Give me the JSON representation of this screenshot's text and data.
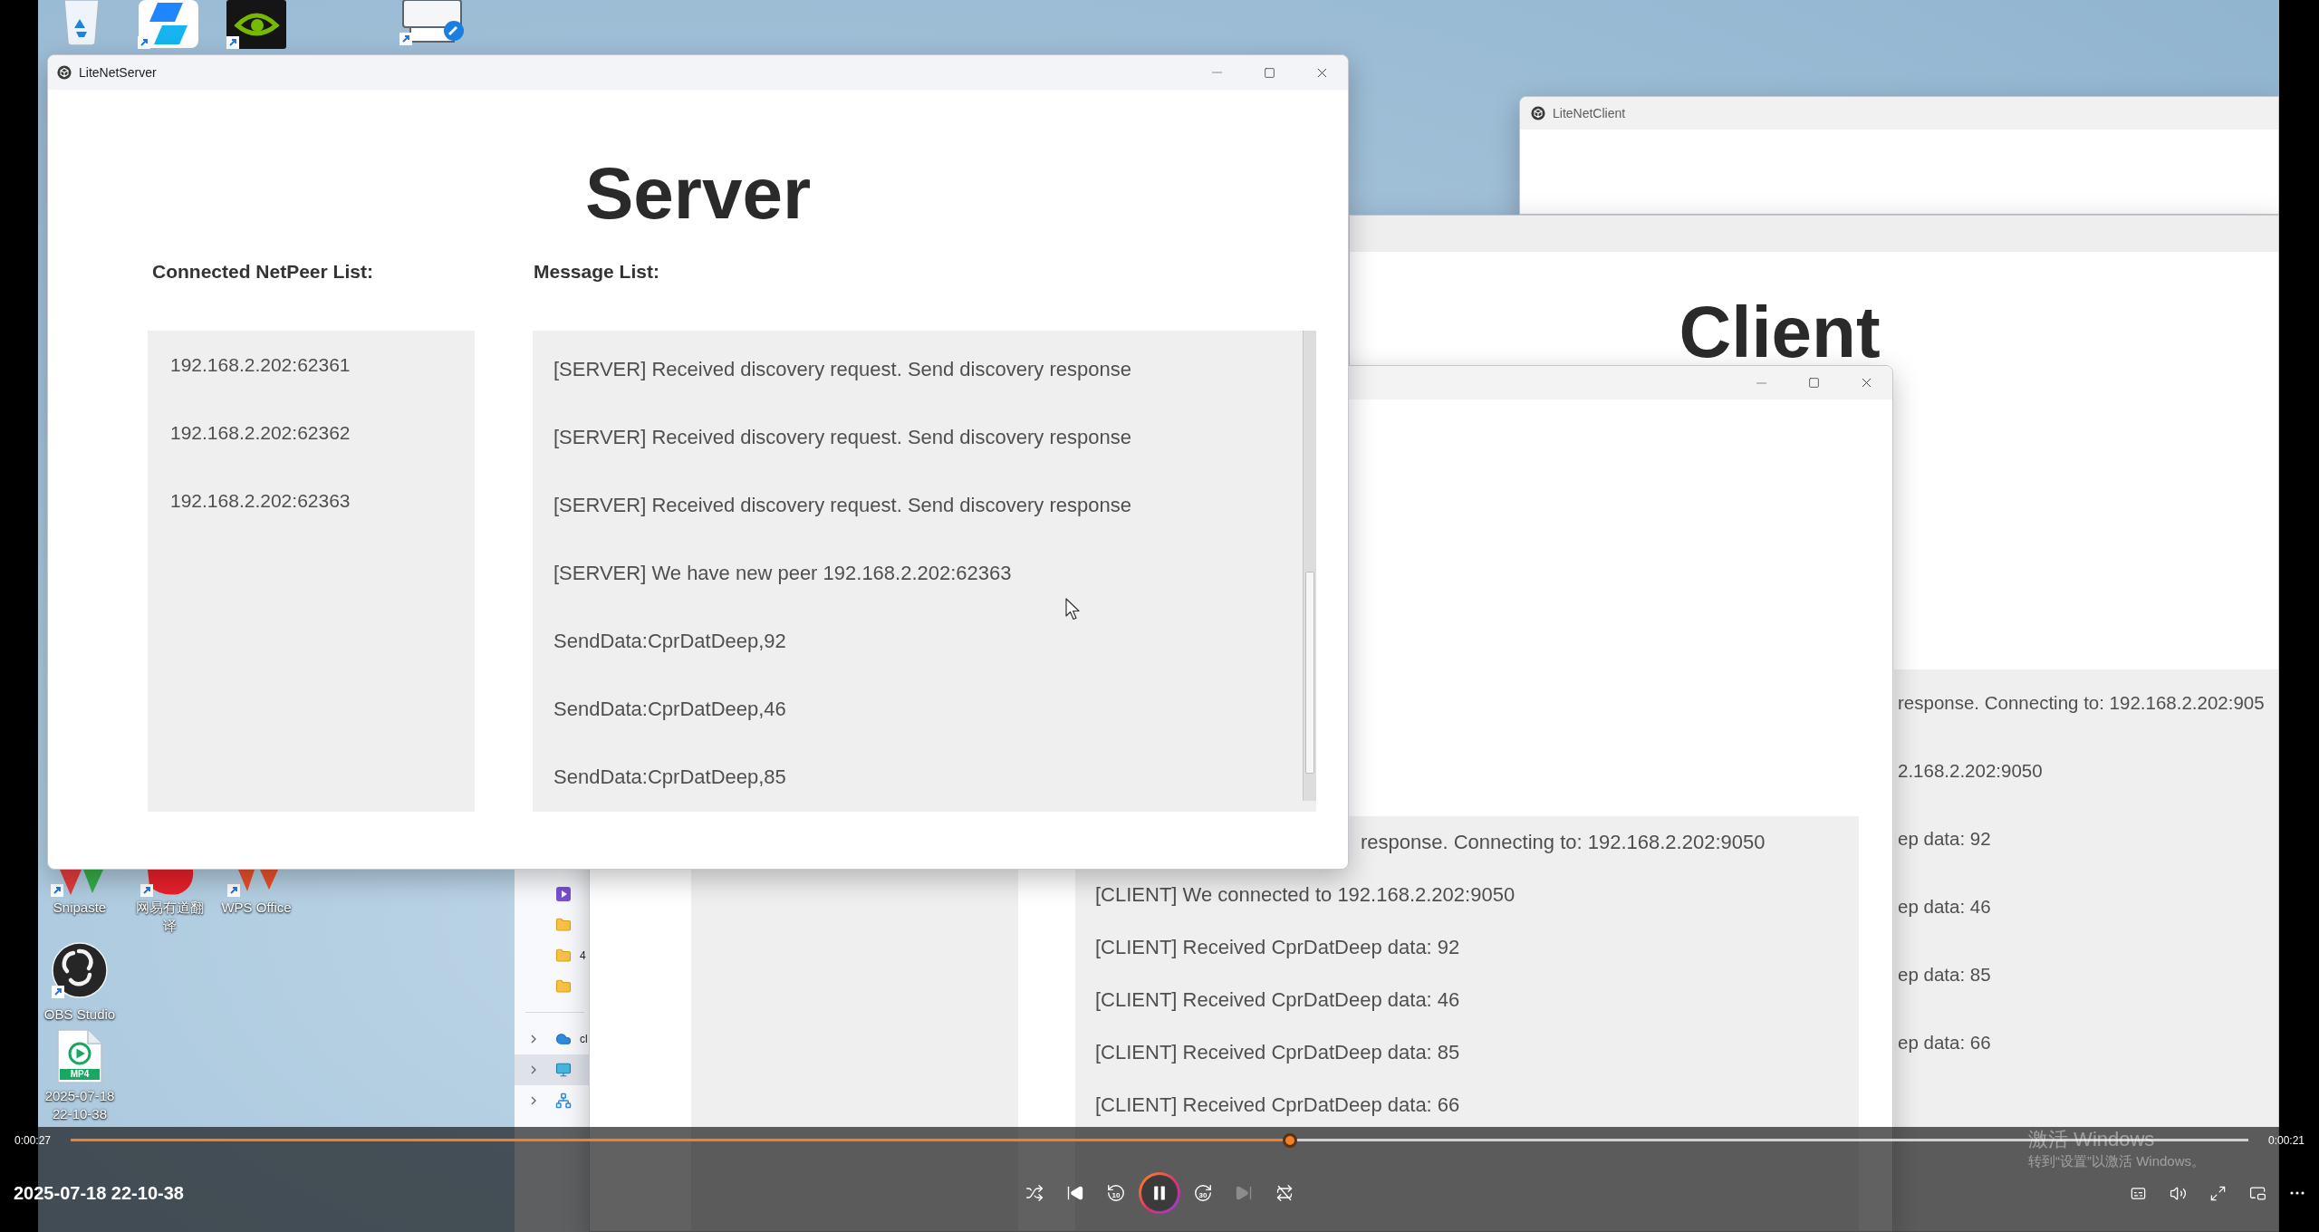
{
  "desktop": {
    "icons": [
      {
        "kind": "bin",
        "shortcut": false
      },
      {
        "kind": "tile",
        "shortcut": true
      },
      {
        "kind": "eye",
        "shortcut": true
      },
      {
        "kind": "printer",
        "shortcut": true
      },
      {
        "kind": "triangle",
        "shortcut": true,
        "label": "Snipaste"
      },
      {
        "kind": "blob",
        "shortcut": true,
        "label": "网易有道翻译"
      },
      {
        "kind": "flame",
        "shortcut": true,
        "label": "WPS Office"
      },
      {
        "kind": "disc",
        "shortcut": true,
        "label": "OBS Studio"
      },
      {
        "kind": "video",
        "shortcut": false,
        "label": "2025-07-18 22-10-38",
        "badge": "MP4"
      }
    ]
  },
  "explorer": {
    "quick_access": [
      {
        "kind": "video"
      },
      {
        "kind": "folder"
      },
      {
        "kind": "folder",
        "label": "4"
      },
      {
        "kind": "folder"
      }
    ],
    "tree": [
      {
        "kind": "cloud",
        "label": "cl",
        "expanded": false,
        "selected": false
      },
      {
        "kind": "pc",
        "expanded": false,
        "selected": true
      },
      {
        "kind": "network",
        "expanded": false,
        "selected": false
      }
    ]
  },
  "client_window_back": {
    "title": "LiteNetClient"
  },
  "client_window_middle": {
    "heading": "Client",
    "messages": [
      "response. Connecting to: 192.168.2.202:905",
      "2.168.2.202:9050",
      "ep data: 92",
      "ep data: 46",
      "ep data: 85",
      "ep data: 66"
    ]
  },
  "client_window_front": {
    "messages": [
      "response. Connecting to: 192.168.2.202:9050",
      "[CLIENT] We connected to 192.168.2.202:9050",
      "[CLIENT] Received CprDatDeep data: 92",
      "[CLIENT] Received CprDatDeep data: 46",
      "[CLIENT] Received CprDatDeep data: 85",
      "[CLIENT] Received CprDatDeep data: 66"
    ]
  },
  "server_window": {
    "title": "LiteNetServer",
    "heading": "Server",
    "peers_label": "Connected NetPeer List:",
    "messages_label": "Message List:",
    "peers": [
      "192.168.2.202:62361",
      "192.168.2.202:62362",
      "192.168.2.202:62363"
    ],
    "messages": [
      "[SERVER] Received discovery request. Send discovery response",
      "[SERVER] Received discovery request. Send discovery response",
      "[SERVER] Received discovery request. Send discovery response",
      "[SERVER] We have new peer 192.168.2.202:62363",
      "SendData:CprDatDeep,92",
      "SendData:CprDatDeep,46",
      "SendData:CprDatDeep,85"
    ]
  },
  "player": {
    "title": "2025-07-18 22-10-38",
    "elapsed": "0:00:27",
    "remaining": "0:00:21",
    "progress": {
      "level": 0.56
    },
    "controls": [
      {
        "kind": "shuffle",
        "disabled": false
      },
      {
        "kind": "previous",
        "disabled": false
      },
      {
        "kind": "skip_back",
        "text": "10",
        "disabled": false
      },
      {
        "kind": "play_pause",
        "playing": true,
        "disabled": false
      },
      {
        "kind": "skip_forward",
        "text": "30",
        "disabled": false
      },
      {
        "kind": "next",
        "disabled": true
      },
      {
        "kind": "repeat",
        "disabled": false
      }
    ],
    "options": [
      {
        "kind": "subtitles"
      },
      {
        "kind": "volume"
      },
      {
        "kind": "fullscreen"
      },
      {
        "kind": "miniplayer"
      },
      {
        "kind": "more"
      }
    ]
  },
  "activation_notice": {
    "title": "激活 Windows",
    "text": "转到“设置”以激活 Windows。"
  }
}
